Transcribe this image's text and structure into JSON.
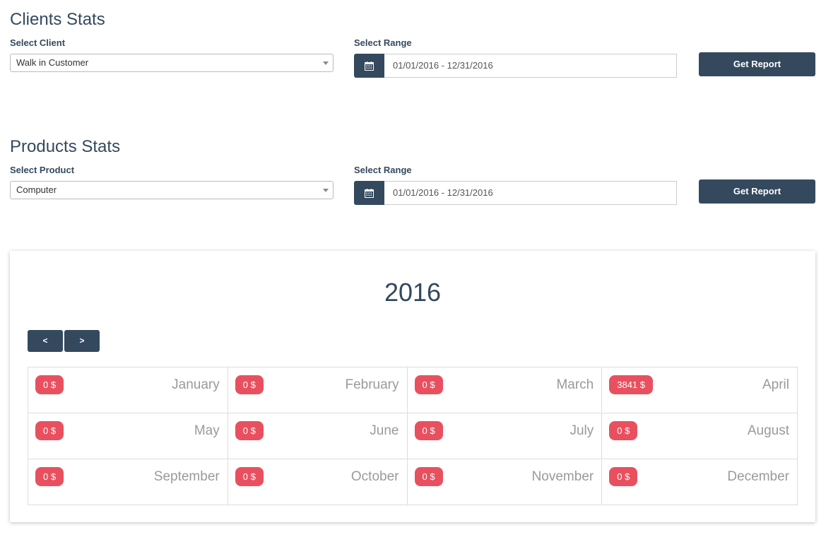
{
  "clients": {
    "title": "Clients Stats",
    "select_label": "Select Client",
    "select_value": "Walk in Customer",
    "range_label": "Select Range",
    "range_value": "01/01/2016 - 12/31/2016",
    "button_label": "Get Report"
  },
  "products": {
    "title": "Products Stats",
    "select_label": "Select Product",
    "select_value": "Computer",
    "range_label": "Select Range",
    "range_value": "01/01/2016 - 12/31/2016",
    "button_label": "Get Report"
  },
  "calendar": {
    "year": "2016",
    "prev_label": "<",
    "next_label": ">",
    "months": [
      {
        "name": "January",
        "amount": "0 $"
      },
      {
        "name": "February",
        "amount": "0 $"
      },
      {
        "name": "March",
        "amount": "0 $"
      },
      {
        "name": "April",
        "amount": "3841 $"
      },
      {
        "name": "May",
        "amount": "0 $"
      },
      {
        "name": "June",
        "amount": "0 $"
      },
      {
        "name": "July",
        "amount": "0 $"
      },
      {
        "name": "August",
        "amount": "0 $"
      },
      {
        "name": "September",
        "amount": "0 $"
      },
      {
        "name": "October",
        "amount": "0 $"
      },
      {
        "name": "November",
        "amount": "0 $"
      },
      {
        "name": "December",
        "amount": "0 $"
      }
    ]
  },
  "colors": {
    "primary": "#34495e",
    "badge": "#e9505f",
    "month_text": "#9a9a9a"
  },
  "icons": {
    "calendar": "calendar-icon",
    "dropdown": "chevron-down-icon"
  }
}
